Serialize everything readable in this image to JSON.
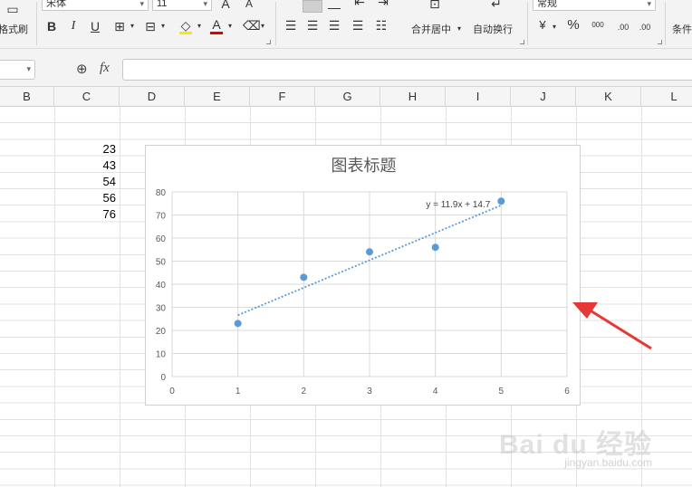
{
  "ribbon": {
    "font_name": "宋体",
    "font_size": "11",
    "format_painter": "格式刷",
    "bold": "B",
    "italic": "I",
    "underline": "U",
    "font_color_letter": "A",
    "merge_center": "合并居中",
    "wrap_text": "自动换行",
    "number_format": "常规",
    "percent": "%",
    "thousands": "000",
    "inc_decimal": ".00",
    "dec_decimal": ".00",
    "conditional": "条件",
    "accent_font_color": "#e00000"
  },
  "formula_bar": {
    "fx_label": "fx"
  },
  "columns": [
    "B",
    "C",
    "D",
    "E",
    "F",
    "G",
    "H",
    "I",
    "J",
    "K",
    "L"
  ],
  "cells": [
    "23",
    "43",
    "54",
    "56",
    "76"
  ],
  "chart_data": {
    "type": "scatter",
    "title": "图表标题",
    "x": [
      1,
      2,
      3,
      4,
      5
    ],
    "y": [
      23,
      43,
      54,
      56,
      76
    ],
    "xlim": [
      0,
      6
    ],
    "ylim": [
      0,
      80
    ],
    "xticks": [
      "0",
      "1",
      "2",
      "3",
      "4",
      "5",
      "6"
    ],
    "yticks": [
      "0",
      "10",
      "20",
      "30",
      "40",
      "50",
      "60",
      "70",
      "80"
    ],
    "trendline": {
      "slope": 11.9,
      "intercept": 14.7,
      "label": "y = 11.9x + 14.7"
    },
    "grid": true,
    "point_color": "#5b9bd5"
  },
  "annotation": {
    "arrow_color": "#e53935"
  },
  "watermark": {
    "brand": "Bai du 经验",
    "url": "jingyan.baidu.com"
  }
}
